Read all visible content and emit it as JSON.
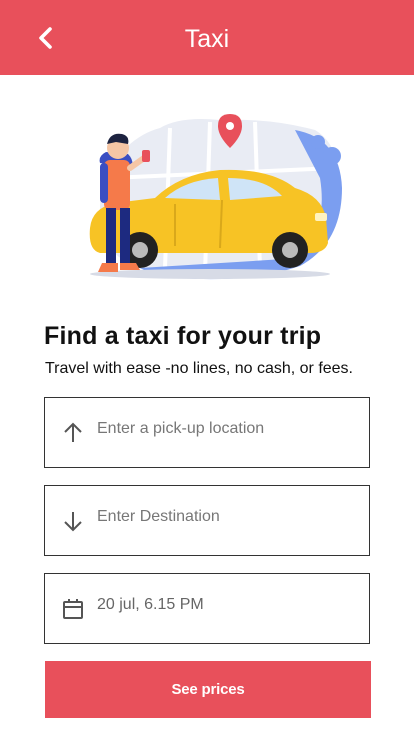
{
  "header": {
    "title": "Taxi",
    "back_icon": "chevron-left-icon",
    "color": "#e8505b"
  },
  "illustration": {
    "subject": "man with phone next to yellow taxi",
    "colors": {
      "car": "#f7c325",
      "map": "#7b9ef0",
      "pin": "#e8505b"
    }
  },
  "main": {
    "heading": "Find a taxi for your trip",
    "subheading": "Travel with ease -no lines, no cash, or fees."
  },
  "form": {
    "pickup": {
      "icon": "arrow-up-icon",
      "placeholder": "Enter a pick-up location",
      "value": ""
    },
    "destination": {
      "icon": "arrow-down-icon",
      "placeholder": "Enter Destination",
      "value": ""
    },
    "datetime": {
      "icon": "calendar-icon",
      "value": "20 jul, 6.15 PM"
    }
  },
  "actions": {
    "see_prices_label": "See prices",
    "accent": "#e8505b"
  }
}
